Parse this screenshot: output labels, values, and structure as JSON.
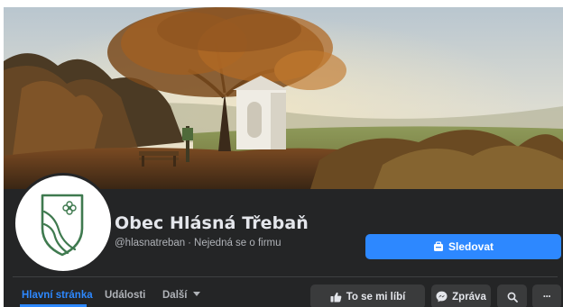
{
  "page": {
    "name": "Obec Hlásná Třebaň",
    "handle": "@hlasnatreban",
    "separator": "·",
    "category": "Nejedná se o firmu"
  },
  "actions": {
    "follow_label": "Sledovat",
    "like_label": "To se mi líbí",
    "message_label": "Zpráva",
    "search_icon": "search-icon",
    "more_label": "···"
  },
  "nav": {
    "tabs": [
      {
        "label": "Hlavní stránka",
        "active": true
      },
      {
        "label": "Události",
        "active": false
      },
      {
        "label": "Další",
        "active": false
      }
    ]
  },
  "colors": {
    "accent": "#2d88ff",
    "band": "#242526",
    "button_dark": "#3a3b3c",
    "text_primary": "#e4e6eb",
    "text_secondary": "#b0b3b8",
    "crest_green": "#3f7a4f"
  }
}
